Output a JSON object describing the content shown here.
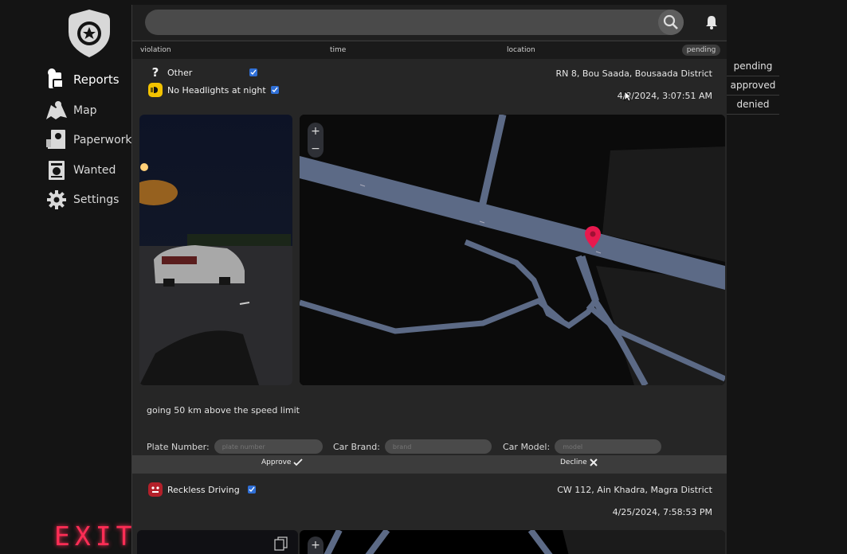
{
  "sidebar": {
    "items": [
      {
        "label": "Reports",
        "icon": "reports-icon"
      },
      {
        "label": "Map",
        "icon": "map-icon"
      },
      {
        "label": "Paperwork",
        "icon": "paperwork-icon"
      },
      {
        "label": "Wanted",
        "icon": "wanted-poster-icon"
      },
      {
        "label": "Settings",
        "icon": "gear-icon"
      }
    ],
    "exit_label": "EXIT"
  },
  "columns": {
    "violation": "violation",
    "time": "time",
    "location": "location",
    "status_filter": "pending"
  },
  "status_options": [
    "pending",
    "approved",
    "denied"
  ],
  "reports": [
    {
      "violations": [
        {
          "label": "Other",
          "icon": "question-mark-icon",
          "checked": true
        },
        {
          "label": "No Headlights at night",
          "icon": "headlight-icon",
          "checked": true
        }
      ],
      "location": "RN 8, Bou Saada, Bousaada District",
      "time": "4/8/2024, 3:07:51 AM",
      "description": "going 50 km above the speed limit",
      "plate_label": "Plate Number:",
      "plate_placeholder": "plate number",
      "brand_label": "Car Brand:",
      "brand_placeholder": "brand",
      "model_label": "Car Model:",
      "model_placeholder": "model",
      "approve_label": "Approve",
      "decline_label": "Decline"
    },
    {
      "violations": [
        {
          "label": "Reckless Driving",
          "icon": "reckless-driving-icon",
          "checked": true
        }
      ],
      "location": "CW 112, Ain Khadra, Magra District",
      "time": "4/25/2024, 7:58:53 PM"
    }
  ],
  "colors": {
    "accent": "#2f6fd6",
    "exit": "#ff2d55",
    "marker": "#e8194e",
    "road": "#5c6a86"
  }
}
